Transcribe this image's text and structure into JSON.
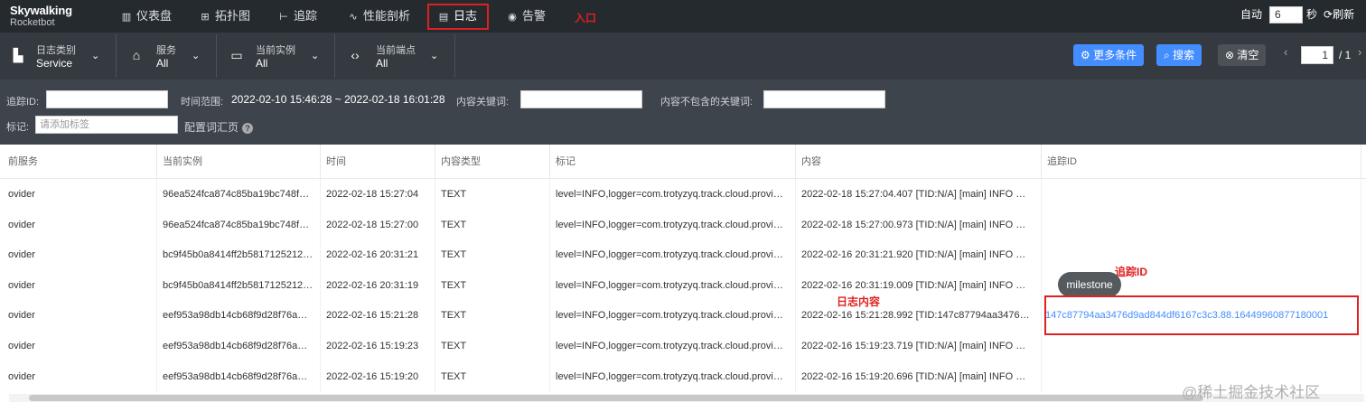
{
  "app": {
    "logo_line1": "Skywalking",
    "logo_line2": "Rocketbot"
  },
  "nav": [
    {
      "label": "仪表盘",
      "icon": "dashboard-icon",
      "glyph": "▥"
    },
    {
      "label": "拓扑图",
      "icon": "topology-icon",
      "glyph": "⊞"
    },
    {
      "label": "追踪",
      "icon": "trace-icon",
      "glyph": "⊢"
    },
    {
      "label": "性能剖析",
      "icon": "profile-icon",
      "glyph": "∿"
    },
    {
      "label": "日志",
      "icon": "log-icon",
      "glyph": "▤",
      "active": true
    },
    {
      "label": "告警",
      "icon": "alarm-icon",
      "glyph": "◉"
    }
  ],
  "annotations": {
    "entry": "入口",
    "trace_id": "追踪ID",
    "log_content": "日志内容"
  },
  "auto_refresh": {
    "label": "自动",
    "value": "6",
    "unit": "秒",
    "refresh_label": "刷新"
  },
  "selectors": [
    {
      "title": "日志类别",
      "value": "Service",
      "icon": "chart-icon"
    },
    {
      "title": "服务",
      "value": "All",
      "icon": "service-icon"
    },
    {
      "title": "当前实例",
      "value": "All",
      "icon": "instance-icon"
    },
    {
      "title": "当前端点",
      "value": "All",
      "icon": "endpoint-icon"
    }
  ],
  "actions": {
    "more_conditions": "更多条件",
    "search": "搜索",
    "clear": "清空"
  },
  "pagination": {
    "current": "1",
    "total": "/ 1"
  },
  "filters": {
    "trace_id_label": "追踪ID:",
    "trace_id_value": "",
    "time_range_label": "时间范围:",
    "time_range_value": "2022-02-10 15:46:28 ~ 2022-02-18 16:01:28",
    "keywords_label": "内容关键词:",
    "exclude_keywords_label": "内容不包含的关键词:",
    "tags_label": "标记:",
    "tags_placeholder": "请添加标签",
    "config_vocab": "配置词汇页"
  },
  "table": {
    "columns": [
      "前服务",
      "当前实例",
      "时间",
      "内容类型",
      "标记",
      "内容",
      "追踪ID"
    ],
    "rows": [
      [
        "ovider",
        "96ea524fca874c85ba19bc748f…",
        "2022-02-18 15:27:04",
        "TEXT",
        "level=INFO,logger=com.trotyzyq.track.cloud.provi…",
        "2022-02-18 15:27:04.407 [TID:N/A] [main] INFO …",
        ""
      ],
      [
        "ovider",
        "96ea524fca874c85ba19bc748f…",
        "2022-02-18 15:27:00",
        "TEXT",
        "level=INFO,logger=com.trotyzyq.track.cloud.provi…",
        "2022-02-18 15:27:00.973 [TID:N/A] [main] INFO …",
        ""
      ],
      [
        "ovider",
        "bc9f45b0a8414ff2b5817125212…",
        "2022-02-16 20:31:21",
        "TEXT",
        "level=INFO,logger=com.trotyzyq.track.cloud.provi…",
        "2022-02-16 20:31:21.920 [TID:N/A] [main] INFO …",
        ""
      ],
      [
        "ovider",
        "bc9f45b0a8414ff2b5817125212…",
        "2022-02-16 20:31:19",
        "TEXT",
        "level=INFO,logger=com.trotyzyq.track.cloud.provi…",
        "2022-02-16 20:31:19.009 [TID:N/A] [main] INFO …",
        ""
      ],
      [
        "ovider",
        "eef953a98db14cb68f9d28f76a…",
        "2022-02-16 15:21:28",
        "TEXT",
        "level=INFO,logger=com.trotyzyq.track.cloud.provi…",
        "2022-02-16 15:21:28.992 [TID:147c87794aa3476…",
        "147c87794aa3476d9ad844df6167c3c3.88.16449960877180001"
      ],
      [
        "ovider",
        "eef953a98db14cb68f9d28f76a…",
        "2022-02-16 15:19:23",
        "TEXT",
        "level=INFO,logger=com.trotyzyq.track.cloud.provi…",
        "2022-02-16 15:19:23.719 [TID:N/A] [main] INFO …",
        ""
      ],
      [
        "ovider",
        "eef953a98db14cb68f9d28f76a…",
        "2022-02-16 15:19:20",
        "TEXT",
        "level=INFO,logger=com.trotyzyq.track.cloud.provi…",
        "2022-02-16 15:19:20.696 [TID:N/A] [main] INFO …",
        ""
      ]
    ]
  },
  "tooltip": "milestone",
  "watermark": "@稀土掘金技术社区",
  "colors": {
    "nav_bg": "#252a2f",
    "selector_bg": "#343a40",
    "filter_bg": "#3d444b",
    "accent": "#448dfe",
    "annotation": "#e02020"
  }
}
